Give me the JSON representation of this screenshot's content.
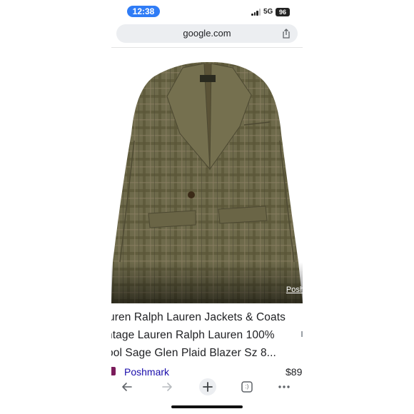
{
  "status_bar": {
    "time": "12:38",
    "network": "5G",
    "battery": "96"
  },
  "browser": {
    "url": "google.com",
    "share_icon": "share-icon"
  },
  "result": {
    "image_description_icon": "blazer-photo",
    "source_chip": "Posh",
    "title_lines": [
      "uren Ralph Lauren Jackets & Coats",
      "ntage Lauren Ralph Lauren 100%",
      "ool Sage Glen Plaid Blazer Sz 8..."
    ],
    "source_name": "Poshmark",
    "price": "$89"
  },
  "toolbar": {
    "back_icon": "arrow-left-icon",
    "forward_icon": "arrow-right-icon",
    "new_tab_icon": "plus-icon",
    "tabs_label": ":)",
    "menu_icon": "more-dots-icon"
  },
  "colors": {
    "accent": "#2f7cf6",
    "link": "#1a0dab",
    "jacket": "#6f6a4a"
  }
}
